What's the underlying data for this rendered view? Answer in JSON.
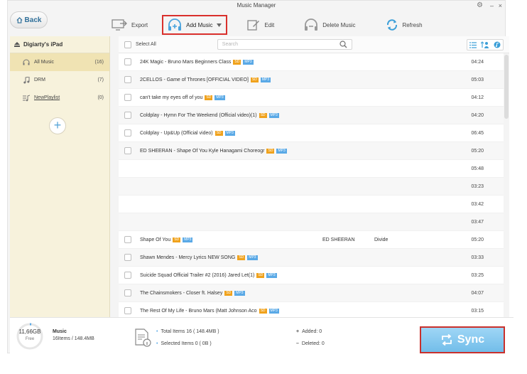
{
  "window": {
    "title": "Music Manager",
    "settings_icon": "gear-icon"
  },
  "nav": {
    "back_label": "Back"
  },
  "toolbar": {
    "export_label": "Export",
    "add_music_label": "Add Music",
    "edit_label": "Edit",
    "delete_label": "Delete Music",
    "refresh_label": "Refresh"
  },
  "sidebar": {
    "device_name": "Digiarty's iPad",
    "items": [
      {
        "label": "All Music",
        "count": "(16)",
        "icon": "headphones-icon",
        "active": true
      },
      {
        "label": "DRM",
        "count": "(7)",
        "icon": "music-note-icon",
        "active": false
      },
      {
        "label": "NewPlaylist",
        "count": "(0)",
        "icon": "playlist-icon",
        "active": false
      }
    ],
    "add_playlist_symbol": "+"
  },
  "list": {
    "select_all_label": "Select All",
    "search_placeholder": "Search",
    "rows": [
      {
        "title": "24K Magic - Bruno Mars   Beginners Class",
        "badges": [
          "SD",
          "MP3"
        ],
        "artist": "",
        "album": "",
        "duration": "04:24"
      },
      {
        "title": "2CELLOS - Game of Thrones [OFFICIAL VIDEO]",
        "badges": [
          "SD",
          "MP3"
        ],
        "artist": "",
        "album": "",
        "duration": "05:03"
      },
      {
        "title": "can't take my eyes off of you",
        "badges": [
          "SD",
          "MP3"
        ],
        "artist": "",
        "album": "",
        "duration": "04:12"
      },
      {
        "title": "Coldplay - Hymn For The Weekend (Official video)(1)",
        "badges": [
          "SD",
          "MP3"
        ],
        "artist": "",
        "album": "",
        "duration": "04:20"
      },
      {
        "title": "Coldplay - Up&Up (Official video)",
        "badges": [
          "SD",
          "MP3"
        ],
        "artist": "",
        "album": "",
        "duration": "06:45"
      },
      {
        "title": "ED SHEERAN - Shape Of You   Kyle Hanagami Choreogr",
        "badges": [
          "SD",
          "MP3"
        ],
        "artist": "",
        "album": "",
        "duration": "05:20"
      },
      {
        "title": "",
        "badges": [],
        "artist": "",
        "album": "",
        "duration": "05:48"
      },
      {
        "title": "",
        "badges": [],
        "artist": "",
        "album": "",
        "duration": "03:23"
      },
      {
        "title": "",
        "badges": [],
        "artist": "",
        "album": "",
        "duration": "03:42"
      },
      {
        "title": "",
        "badges": [],
        "artist": "",
        "album": "",
        "duration": "03:47"
      },
      {
        "title": "Shape Of You",
        "badges": [
          "SD",
          "MP3"
        ],
        "artist": "ED SHEERAN",
        "album": "Divide",
        "duration": "05:20"
      },
      {
        "title": "Shawn Mendes - Mercy Lyrics NEW SONG",
        "badges": [
          "SD",
          "MP3"
        ],
        "artist": "",
        "album": "",
        "duration": "03:33"
      },
      {
        "title": "Suicide Squad Official Trailer #2 (2016) Jared Let(1)",
        "badges": [
          "SD",
          "MP3"
        ],
        "artist": "",
        "album": "",
        "duration": "03:25"
      },
      {
        "title": "The Chainsmokers - Closer ft. Halsey",
        "badges": [
          "SD",
          "MP3"
        ],
        "artist": "",
        "album": "",
        "duration": "04:07"
      },
      {
        "title": "The Rest Of My Life - Bruno Mars (Matt Johnson Aco",
        "badges": [
          "SD",
          "MP3"
        ],
        "artist": "",
        "album": "",
        "duration": "03:15"
      }
    ]
  },
  "footer": {
    "storage_free": "11,66GB",
    "free_label": "Free",
    "category_label": "Music",
    "category_stats": "16Items / 148.4MB",
    "total_items": "Total Items 16 ( 148.4MB )",
    "selected_items": "Selected Items 0 ( 0B )",
    "added": "Added: 0",
    "deleted": "Deleted: 0",
    "sync_label": "Sync"
  },
  "colors": {
    "accent": "#5aa9e6",
    "highlight_border": "#d9302c",
    "sidebar_bg": "#f7f2dc",
    "badge_sd": "#f0a21c",
    "badge_mp3": "#5aa9e6"
  }
}
